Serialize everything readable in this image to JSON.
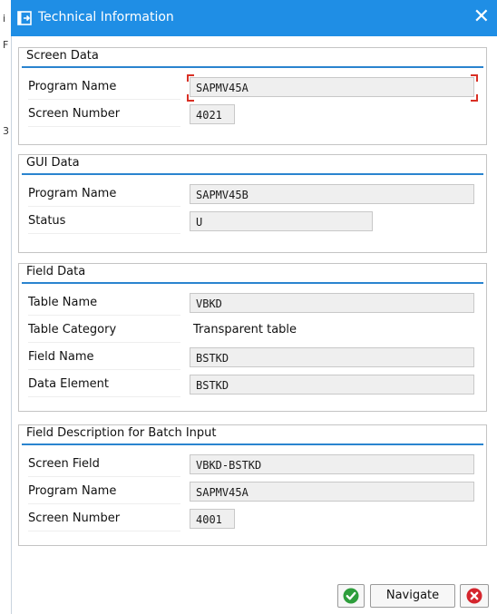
{
  "dialog": {
    "title": "Technical Information",
    "close_symbol": "✕"
  },
  "background_chars": {
    "a": "i",
    "b": "F",
    "c": "3"
  },
  "screen_data": {
    "title": "Screen Data",
    "program_name_label": "Program Name",
    "program_name_value": "SAPMV45A",
    "screen_number_label": "Screen Number",
    "screen_number_value": "4021"
  },
  "gui_data": {
    "title": "GUI Data",
    "program_name_label": "Program Name",
    "program_name_value": "SAPMV45B",
    "status_label": "Status",
    "status_value": "U"
  },
  "field_data": {
    "title": "Field Data",
    "table_name_label": "Table Name",
    "table_name_value": "VBKD",
    "table_category_label": "Table Category",
    "table_category_value": "Transparent table",
    "field_name_label": "Field Name",
    "field_name_value": "BSTKD",
    "data_element_label": "Data Element",
    "data_element_value": "BSTKD"
  },
  "batch_input": {
    "title": "Field Description for Batch Input",
    "screen_field_label": "Screen Field",
    "screen_field_value": "VBKD-BSTKD",
    "program_name_label": "Program Name",
    "program_name_value": "SAPMV45A",
    "screen_number_label": "Screen Number",
    "screen_number_value": "4001"
  },
  "buttons": {
    "navigate_label": "Navigate"
  },
  "colors": {
    "titlebar": "#1f8ee5",
    "section_line": "#2a84cf",
    "ok_green": "#2e9e3c",
    "cancel_red": "#d5262e"
  },
  "icons": {
    "title": "technical-info-icon",
    "close": "close-icon",
    "ok": "checkmark-icon",
    "cancel": "cancel-icon"
  }
}
